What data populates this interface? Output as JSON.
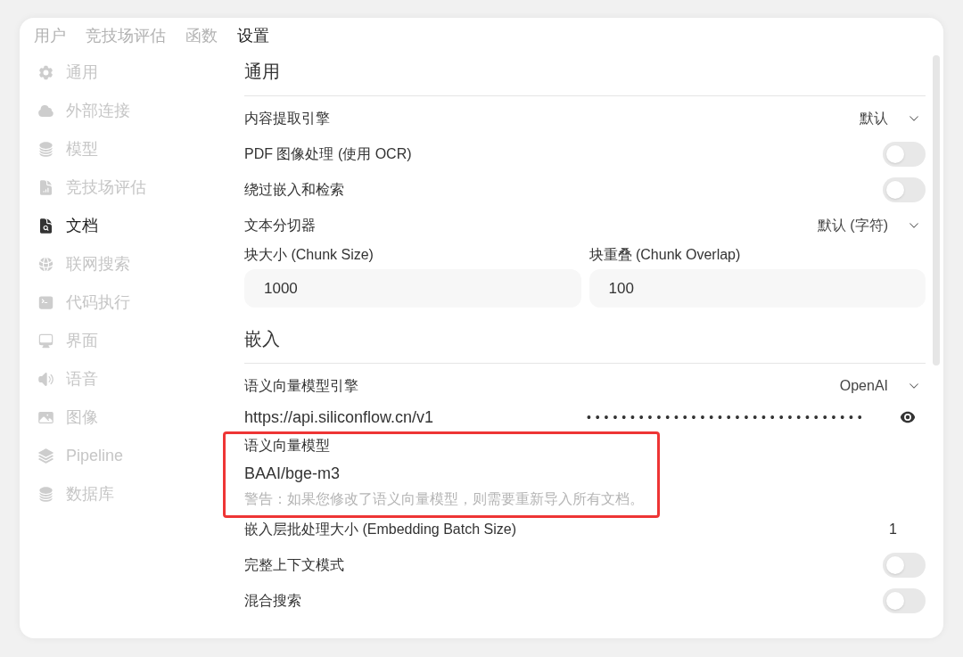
{
  "tabs": [
    {
      "label": "用户",
      "selected": false
    },
    {
      "label": "竞技场评估",
      "selected": false
    },
    {
      "label": "函数",
      "selected": false
    },
    {
      "label": "设置",
      "selected": true
    }
  ],
  "sidebar": {
    "items": [
      {
        "label": "通用",
        "selected": false
      },
      {
        "label": "外部连接",
        "selected": false
      },
      {
        "label": "模型",
        "selected": false
      },
      {
        "label": "竞技场评估",
        "selected": false
      },
      {
        "label": "文档",
        "selected": true
      },
      {
        "label": "联网搜索",
        "selected": false
      },
      {
        "label": "代码执行",
        "selected": false
      },
      {
        "label": "界面",
        "selected": false
      },
      {
        "label": "语音",
        "selected": false
      },
      {
        "label": "图像",
        "selected": false
      },
      {
        "label": "Pipeline",
        "selected": false
      },
      {
        "label": "数据库",
        "selected": false
      }
    ]
  },
  "sections": [
    {
      "title": "通用",
      "rows": [
        {
          "kind": "select",
          "label": "内容提取引擎",
          "value": "默认"
        },
        {
          "kind": "toggle",
          "label": "PDF 图像处理 (使用 OCR)",
          "on": false
        },
        {
          "kind": "toggle",
          "label": "绕过嵌入和检索",
          "on": false
        },
        {
          "kind": "select",
          "label": "文本分切器",
          "value": "默认 (字符)"
        },
        {
          "kind": "inputs",
          "fields": [
            {
              "label": "块大小 (Chunk Size)",
              "value": "1000"
            },
            {
              "label": "块重叠 (Chunk Overlap)",
              "value": "100"
            }
          ]
        }
      ]
    },
    {
      "title": "嵌入",
      "rows": [
        {
          "kind": "select",
          "label": "语义向量模型引擎",
          "value": "OpenAI"
        },
        {
          "kind": "endpoint",
          "url": "https://api.siliconflow.cn/v1",
          "key": "••••••••••••••••••••••••••••••••"
        },
        {
          "kind": "model",
          "label": "语义向量模型",
          "value": "BAAI/bge-m3",
          "warning": "警告：如果您修改了语义向量模型，则需要重新导入所有文档。",
          "highlighted": true
        },
        {
          "kind": "value",
          "label": "嵌入层批处理大小 (Embedding Batch Size)",
          "value": "1"
        },
        {
          "kind": "toggle",
          "label": "完整上下文模式",
          "on": false
        },
        {
          "kind": "toggle",
          "label": "混合搜索",
          "on": false
        }
      ]
    }
  ]
}
